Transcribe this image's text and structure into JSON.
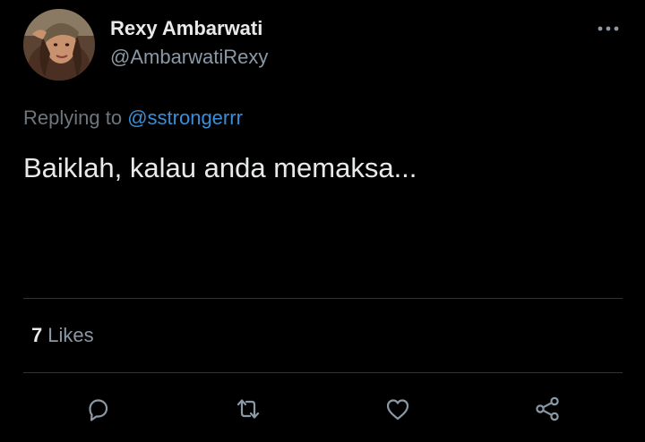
{
  "author": {
    "display_name": "Rexy Ambarwati",
    "handle": "@AmbarwatiRexy",
    "avatar_icon": "profile-photo"
  },
  "reply_context": {
    "prefix": "Replying to",
    "mention": "@sstrongerrr"
  },
  "tweet": {
    "text": "Baiklah, kalau anda memaksa..."
  },
  "stats": {
    "likes_count": "7",
    "likes_label": "Likes"
  },
  "actions": [
    {
      "name": "reply",
      "icon": "speech-bubble-icon"
    },
    {
      "name": "retweet",
      "icon": "retweet-icon"
    },
    {
      "name": "like",
      "icon": "heart-icon"
    },
    {
      "name": "share",
      "icon": "share-icon"
    }
  ],
  "colors": {
    "background": "#000000",
    "primary_text": "#e7e9ea",
    "secondary_text": "#8b98a5",
    "mention": "#3b8ed6",
    "divider": "#2f3336",
    "icon": "#8b98a5"
  }
}
